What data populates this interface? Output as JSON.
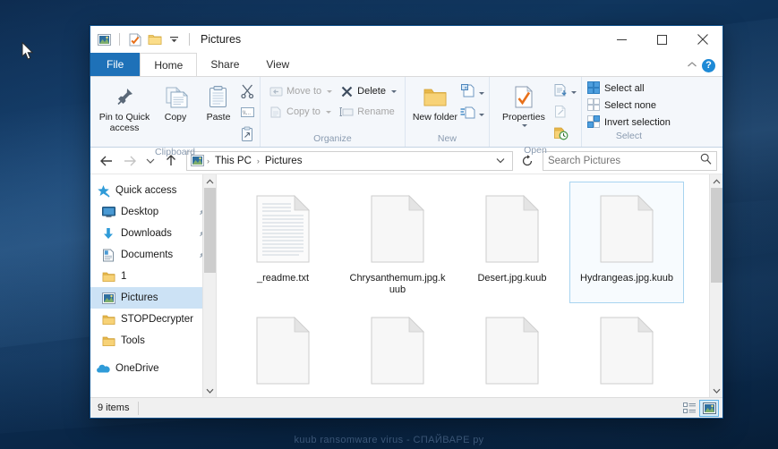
{
  "desktop": {
    "watermark": "kuub ransomware virus - СПАЙВАРЕ ру",
    "cursor_icon": "mouse-pointer-icon",
    "background_color": "#0a2546"
  },
  "window": {
    "title": "Pictures",
    "quick_access_toolbar": [
      {
        "icon": "pictures-folder-icon",
        "name": "window-menu-icon"
      },
      {
        "icon": "properties-checkmark-icon",
        "name": "qat-properties"
      },
      {
        "icon": "new-folder-icon",
        "name": "qat-new-folder"
      },
      {
        "icon": "chevron-down-icon",
        "name": "qat-customize"
      }
    ],
    "controls": {
      "minimize": "—",
      "maximize": "☐",
      "close": "✕"
    },
    "help_label": "?",
    "collapse_ribbon_icon": "chevron-up-icon"
  },
  "tabs": [
    {
      "label": "File",
      "kind": "file",
      "active": false
    },
    {
      "label": "Home",
      "kind": "normal",
      "active": true
    },
    {
      "label": "Share",
      "kind": "normal",
      "active": false
    },
    {
      "label": "View",
      "kind": "normal",
      "active": false
    }
  ],
  "ribbon": {
    "groups": [
      {
        "label": "Clipboard",
        "big_buttons": [
          {
            "label": "Pin to Quick access",
            "icon": "pin-icon",
            "disabled": false
          },
          {
            "label": "Copy",
            "icon": "copy-icon",
            "disabled": false
          },
          {
            "label": "Paste",
            "icon": "paste-icon",
            "disabled": false
          }
        ],
        "small_icons": [
          {
            "name": "cut-scissors-icon"
          },
          {
            "name": "copy-path-icon"
          },
          {
            "name": "paste-shortcut-icon"
          }
        ]
      },
      {
        "label": "Organize",
        "small_buttons": [
          {
            "label": "Move to",
            "icon": "move-to-icon",
            "disabled": true,
            "caret": true
          },
          {
            "label": "Copy to",
            "icon": "copy-to-icon",
            "disabled": true,
            "caret": true
          },
          {
            "label": "Delete",
            "icon": "delete-x-icon",
            "disabled": false,
            "caret": true
          },
          {
            "label": "Rename",
            "icon": "rename-icon",
            "disabled": true,
            "caret": false
          }
        ]
      },
      {
        "label": "New",
        "big_buttons": [
          {
            "label": "New folder",
            "icon": "new-folder-icon",
            "disabled": false
          }
        ],
        "small_icons": [
          {
            "name": "new-item-icon",
            "caret": true
          },
          {
            "name": "easy-access-icon",
            "caret": true
          }
        ]
      },
      {
        "label": "Open",
        "big_buttons": [
          {
            "label": "Properties",
            "icon": "properties-checkmark-icon",
            "disabled": false,
            "caret": true
          }
        ],
        "small_icons": [
          {
            "name": "open-with-icon",
            "caret": true
          },
          {
            "name": "edit-icon",
            "caret": false
          },
          {
            "name": "history-icon",
            "caret": false
          }
        ]
      },
      {
        "label": "Select",
        "select_rows": [
          {
            "label": "Select all",
            "icon": "select-all-icon"
          },
          {
            "label": "Select none",
            "icon": "select-none-icon"
          },
          {
            "label": "Invert selection",
            "icon": "invert-selection-icon"
          }
        ]
      }
    ]
  },
  "address_bar": {
    "back_icon": "arrow-left-icon",
    "forward_icon": "arrow-right-icon",
    "recent_icon": "chevron-down-icon",
    "up_icon": "arrow-up-icon",
    "path_icon": "pictures-folder-icon",
    "breadcrumbs": [
      "This PC",
      "Pictures"
    ],
    "separator": "›",
    "dropdown_icon": "chevron-down-icon",
    "refresh_icon": "refresh-icon",
    "search": {
      "placeholder": "Search Pictures",
      "value": "",
      "icon": "search-icon"
    }
  },
  "nav_pane": {
    "items": [
      {
        "label": "Quick access",
        "icon": "quick-access-star-icon",
        "indent": "root",
        "pinned": false,
        "selected": false
      },
      {
        "label": "Desktop",
        "icon": "desktop-monitor-icon",
        "indent": "child",
        "pinned": true,
        "selected": false
      },
      {
        "label": "Downloads",
        "icon": "downloads-arrow-icon",
        "indent": "child",
        "pinned": true,
        "selected": false
      },
      {
        "label": "Documents",
        "icon": "documents-icon",
        "indent": "child",
        "pinned": true,
        "selected": false
      },
      {
        "label": "1",
        "icon": "folder-icon",
        "indent": "child",
        "pinned": false,
        "selected": false
      },
      {
        "label": "Pictures",
        "icon": "pictures-folder-icon",
        "indent": "child",
        "pinned": false,
        "selected": true
      },
      {
        "label": "STOPDecrypter",
        "icon": "folder-icon",
        "indent": "child",
        "pinned": false,
        "selected": false
      },
      {
        "label": "Tools",
        "icon": "folder-icon",
        "indent": "child",
        "pinned": false,
        "selected": false
      },
      {
        "label": "OneDrive",
        "icon": "onedrive-cloud-icon",
        "indent": "root",
        "pinned": false,
        "selected": false
      }
    ],
    "scroll_up_icon": "chevron-up-icon",
    "scroll_down_icon": "chevron-down-icon"
  },
  "files": [
    {
      "name": "_readme.txt",
      "icon": "text-file-icon",
      "selected": false
    },
    {
      "name": "Chrysanthemum.jpg.kuub",
      "icon": "blank-file-icon",
      "selected": false
    },
    {
      "name": "Desert.jpg.kuub",
      "icon": "blank-file-icon",
      "selected": false
    },
    {
      "name": "Hydrangeas.jpg.kuub",
      "icon": "blank-file-icon",
      "selected": true
    },
    {
      "name": "",
      "icon": "blank-file-icon",
      "selected": false
    },
    {
      "name": "",
      "icon": "blank-file-icon",
      "selected": false
    },
    {
      "name": "",
      "icon": "blank-file-icon",
      "selected": false
    },
    {
      "name": "",
      "icon": "blank-file-icon",
      "selected": false
    }
  ],
  "status_bar": {
    "item_count": "9 items",
    "view_buttons": [
      {
        "name": "details-view-button",
        "icon": "details-view-icon",
        "active": false
      },
      {
        "name": "large-icons-view-button",
        "icon": "large-icons-view-icon",
        "active": true
      }
    ]
  }
}
